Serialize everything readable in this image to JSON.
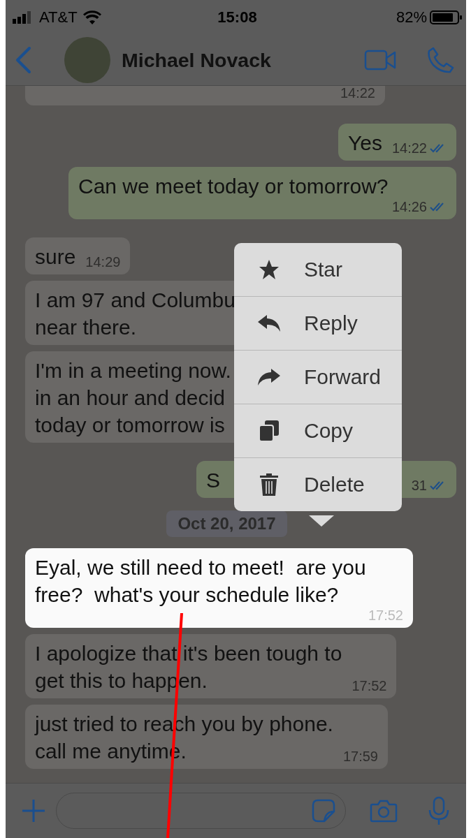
{
  "status_bar": {
    "carrier": "AT&T",
    "time": "15:08",
    "battery": "82%"
  },
  "header": {
    "contact_name": "Michael Novack"
  },
  "messages": [
    {
      "kind": "received",
      "time": "14:22",
      "ticks": false,
      "highlighted": false,
      "partly_hidden": true
    },
    {
      "kind": "sent",
      "text": "Yes",
      "time": "14:22",
      "ticks": true,
      "highlighted": false,
      "partly_hidden": false
    },
    {
      "kind": "sent",
      "text": "Can we meet today or tomorrow?",
      "time": "14:26",
      "ticks": true,
      "highlighted": false,
      "partly_hidden": false
    },
    {
      "kind": "received",
      "text": "sure",
      "time": "14:29",
      "ticks": false,
      "highlighted": false,
      "partly_hidden": false
    },
    {
      "kind": "received",
      "text": "I am 97 and Columbu\nnear there.",
      "ticks": false,
      "highlighted": false,
      "partly_hidden": true
    },
    {
      "kind": "received",
      "text": "I'm in a meeting now.\nin an hour and decid\ntoday or tomorrow is",
      "ticks": false,
      "highlighted": false,
      "partly_hidden": true
    },
    {
      "kind": "sent",
      "text": "S",
      "time": "31",
      "ticks": true,
      "highlighted": false,
      "partly_hidden": true
    },
    {
      "kind": "date",
      "text": "Oct 20, 2017"
    },
    {
      "kind": "received",
      "text": "Eyal, we still need to meet!  are you\nfree?  what's your schedule like?",
      "time": "17:52",
      "ticks": false,
      "highlighted": true,
      "partly_hidden": false
    },
    {
      "kind": "received",
      "text": "I apologize that it's been tough to\nget this to happen.",
      "time": "17:52",
      "ticks": false,
      "highlighted": false,
      "partly_hidden": false
    },
    {
      "kind": "received",
      "text": "just tried to reach you by phone.\ncall me anytime.",
      "time": "17:59",
      "ticks": false,
      "highlighted": false,
      "partly_hidden": false
    }
  ],
  "context_menu": [
    {
      "label": "Star"
    },
    {
      "label": "Reply"
    },
    {
      "label": "Forward"
    },
    {
      "label": "Copy"
    },
    {
      "label": "Delete"
    }
  ]
}
